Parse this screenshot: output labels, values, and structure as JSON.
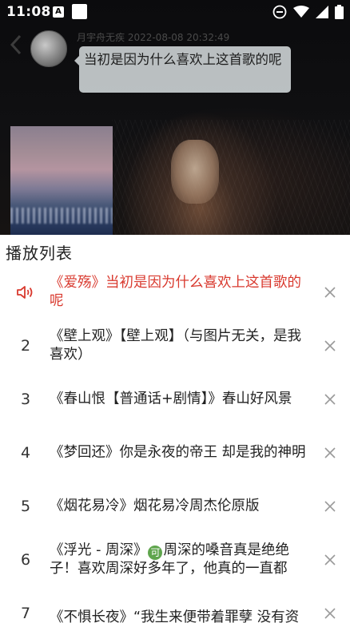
{
  "status_bar": {
    "time": "11:08",
    "notification_icons": [
      "a-icon",
      "square-icon"
    ],
    "right_icons": [
      "do-not-disturb-icon",
      "wifi-icon",
      "signal-icon",
      "battery-icon"
    ]
  },
  "chat": {
    "author_meta": "月宇舟无疾 2022-08-08 20:32:49",
    "message": "当初是因为什么喜欢上这首歌的呢"
  },
  "playlist": {
    "title": "播放列表",
    "items": [
      {
        "index": "",
        "title": "《爱殇》当初是因为什么喜欢上这首歌的呢",
        "active": true
      },
      {
        "index": "2",
        "title": "《壁上观》【壁上观】（与图片无关，是我喜欢）",
        "active": false
      },
      {
        "index": "3",
        "title": "《春山恨【普通话+剧情】》春山好风景",
        "active": false
      },
      {
        "index": "4",
        "title": "《梦回还》你是永夜的帝王 却是我的神明",
        "active": false
      },
      {
        "index": "5",
        "title": "《烟花易冷》烟花易冷周杰伦原版",
        "active": false
      },
      {
        "index": "6",
        "title_before": "《浮光 - 周深》",
        "badge": "可",
        "title_after": "周深的嗓音真是绝绝子！喜欢周深好多年了，他真的一直都",
        "active": false
      },
      {
        "index": "7",
        "title": "《不惧长夜》“我生来便带着罪孽 没有资",
        "active": false
      }
    ]
  },
  "colors": {
    "active_red": "#d93a2f",
    "close_gray": "#9a9a9a",
    "sheet_bg": "#ffffff"
  }
}
